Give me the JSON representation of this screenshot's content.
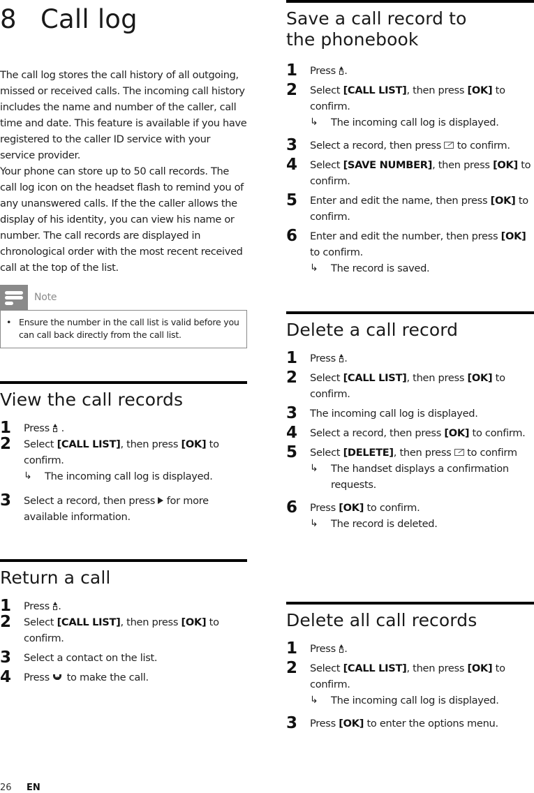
{
  "chapter": {
    "number": "8",
    "title": "Call log"
  },
  "intro": {
    "paragraph1": "The call log stores the call history of all outgoing, missed or received calls. The incoming call history includes the name and number of the caller, call time and date. This feature is available if you have registered to the caller ID service with your service provider.",
    "paragraph2": "Your phone can store up to 50 call records. The call log icon on the headset flash to remind you of any unanswered calls. If the the caller allows the display of his identity, you can view his name or number. The call records are displayed in chronological order with the most recent received call at the top of the list."
  },
  "note": {
    "label": "Note",
    "bullet": "•",
    "text": "Ensure the number in the call list is valid before you can call back directly from the call list."
  },
  "icons": {
    "menu": "menu-call-log-icon",
    "right": "right-arrow-icon",
    "softkey": "softkey-confirm-icon",
    "call": "talk-recall-icon",
    "result_arrow": "↳"
  },
  "sections": {
    "view": {
      "title": "View the call records",
      "steps": [
        {
          "n": "1",
          "pre": "Press",
          "post": " ."
        },
        {
          "n": "2",
          "a": "Select ",
          "b1": "[CALL LIST]",
          "c": ", then press ",
          "b2": "[OK]",
          "d": " to confirm.",
          "result": "The incoming call log is displayed."
        },
        {
          "n": "3",
          "pre": "Select a record, then press",
          "post": " for more available information."
        }
      ]
    },
    "return": {
      "title": "Return a call",
      "steps": [
        {
          "n": "1",
          "pre": "Press",
          "post": "."
        },
        {
          "n": "2",
          "a": "Select ",
          "b1": "[CALL LIST]",
          "c": ", then press ",
          "b2": "[OK]",
          "d": " to confirm."
        },
        {
          "n": "3",
          "text": "Select a contact on the list."
        },
        {
          "n": "4",
          "pre": "Press",
          "post": " to make the call."
        }
      ]
    },
    "save": {
      "title": "Save a call record to the phonebook",
      "steps": [
        {
          "n": "1",
          "pre": "Press",
          "post": "."
        },
        {
          "n": "2",
          "a": "Select ",
          "b1": "[CALL LIST]",
          "c": ", then press ",
          "b2": "[OK]",
          "d": " to confirm.",
          "result": "The incoming call log is displayed."
        },
        {
          "n": "3",
          "pre": "Select a record, then press",
          "post": " to confirm."
        },
        {
          "n": "4",
          "a": "Select ",
          "b1": "[SAVE NUMBER]",
          "c": ", then press ",
          "b2": "[OK]",
          "d": " to confirm."
        },
        {
          "n": "5",
          "a": "Enter and edit the name, then press ",
          "b1": "[OK]",
          "d": " to confirm."
        },
        {
          "n": "6",
          "a": "Enter and edit the number, then press ",
          "b1": "[OK]",
          "d": " to confirm.",
          "result": "The record is saved."
        }
      ]
    },
    "delete": {
      "title": "Delete a call record",
      "steps": [
        {
          "n": "1",
          "pre": "Press",
          "post": "."
        },
        {
          "n": "2",
          "a": "Select ",
          "b1": "[CALL LIST]",
          "c": ", then press ",
          "b2": "[OK]",
          "d": " to confirm."
        },
        {
          "n": "3",
          "text": "The incoming call log is displayed."
        },
        {
          "n": "4",
          "a": "Select a record, then press ",
          "b1": "[OK]",
          "d": " to confirm."
        },
        {
          "n": "5",
          "a": "Select ",
          "b1": "[DELETE]",
          "c": ", then press",
          "post": " to confirm",
          "result": "The handset displays a confirmation requests."
        },
        {
          "n": "6",
          "a": "Press ",
          "b1": "[OK]",
          "d": " to confirm.",
          "result": "The record is deleted."
        }
      ]
    },
    "delete_all": {
      "title": "Delete all call records",
      "steps": [
        {
          "n": "1",
          "pre": "Press",
          "post": "."
        },
        {
          "n": "2",
          "a": "Select ",
          "b1": "[CALL LIST]",
          "c": ", then press ",
          "b2": "[OK]",
          "d": " to confirm.",
          "result": "The incoming call log is displayed."
        },
        {
          "n": "3",
          "a": "Press ",
          "b1": "[OK]",
          "d": " to enter the options menu."
        }
      ]
    }
  },
  "footer": {
    "page": "26",
    "lang": "EN"
  }
}
